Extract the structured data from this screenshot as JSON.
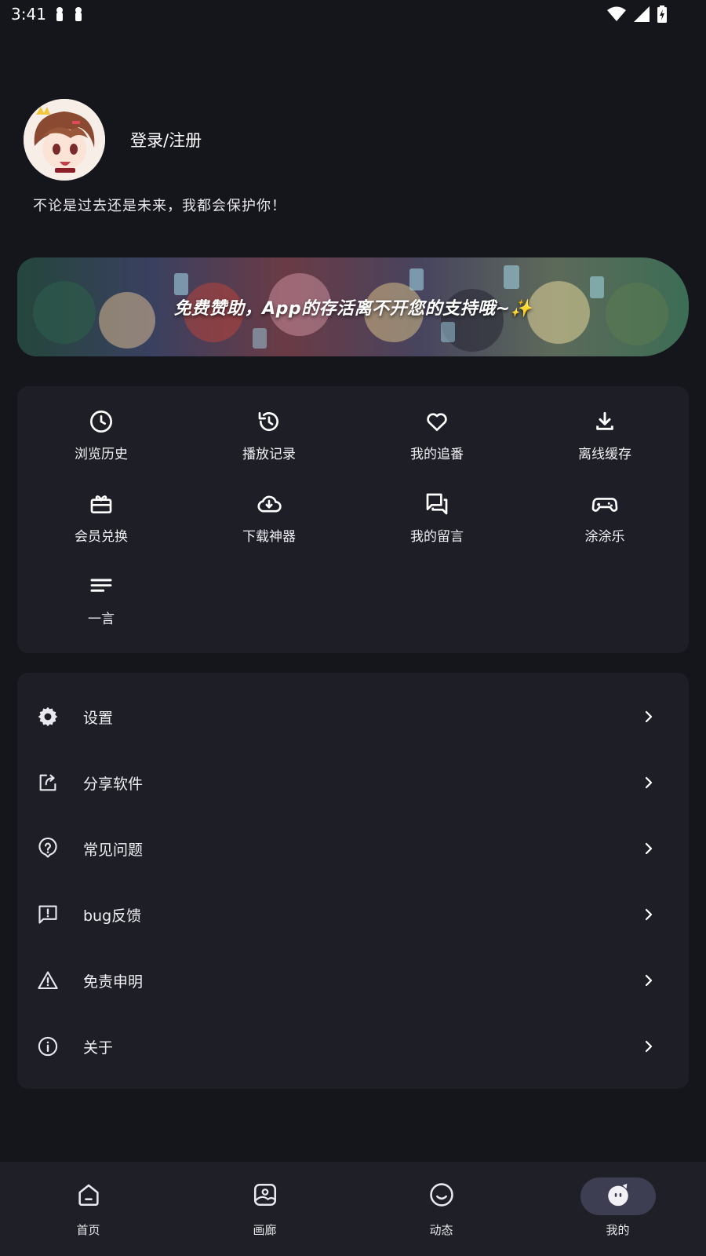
{
  "status_bar": {
    "time": "3:41",
    "icons": [
      "notification-icon",
      "notification-icon",
      "wifi-icon",
      "signal-icon",
      "battery-charging-icon"
    ]
  },
  "profile": {
    "login_label": "登录/注册",
    "motto": "不论是过去还是未来，我都会保护你！"
  },
  "banner": {
    "text": "免费赞助，App的存活离不开您的支持哦~✨"
  },
  "grid_items": [
    {
      "label": "浏览历史",
      "icon": "clock-icon"
    },
    {
      "label": "播放记录",
      "icon": "history-icon"
    },
    {
      "label": "我的追番",
      "icon": "heart-icon"
    },
    {
      "label": "离线缓存",
      "icon": "download-icon"
    },
    {
      "label": "会员兑换",
      "icon": "redeem-icon"
    },
    {
      "label": "下载神器",
      "icon": "cloud-download-icon"
    },
    {
      "label": "我的留言",
      "icon": "forum-icon"
    },
    {
      "label": "涂涂乐",
      "icon": "gamepad-icon"
    },
    {
      "label": "一言",
      "icon": "notes-icon"
    }
  ],
  "menu_items": [
    {
      "label": "设置",
      "icon": "gear-icon"
    },
    {
      "label": "分享软件",
      "icon": "share-icon"
    },
    {
      "label": "常见问题",
      "icon": "help-icon"
    },
    {
      "label": "bug反馈",
      "icon": "feedback-icon"
    },
    {
      "label": "免责申明",
      "icon": "warning-icon"
    },
    {
      "label": "关于",
      "icon": "info-icon"
    }
  ],
  "bottom_nav": [
    {
      "label": "首页",
      "icon": "home-icon",
      "active": false
    },
    {
      "label": "画廊",
      "icon": "gallery-icon",
      "active": false
    },
    {
      "label": "动态",
      "icon": "smile-icon",
      "active": false
    },
    {
      "label": "我的",
      "icon": "mascot-icon",
      "active": true
    }
  ],
  "colors": {
    "background": "#15151c",
    "card": "#1e1e26",
    "nav_active_pill": "#3e3e52"
  }
}
